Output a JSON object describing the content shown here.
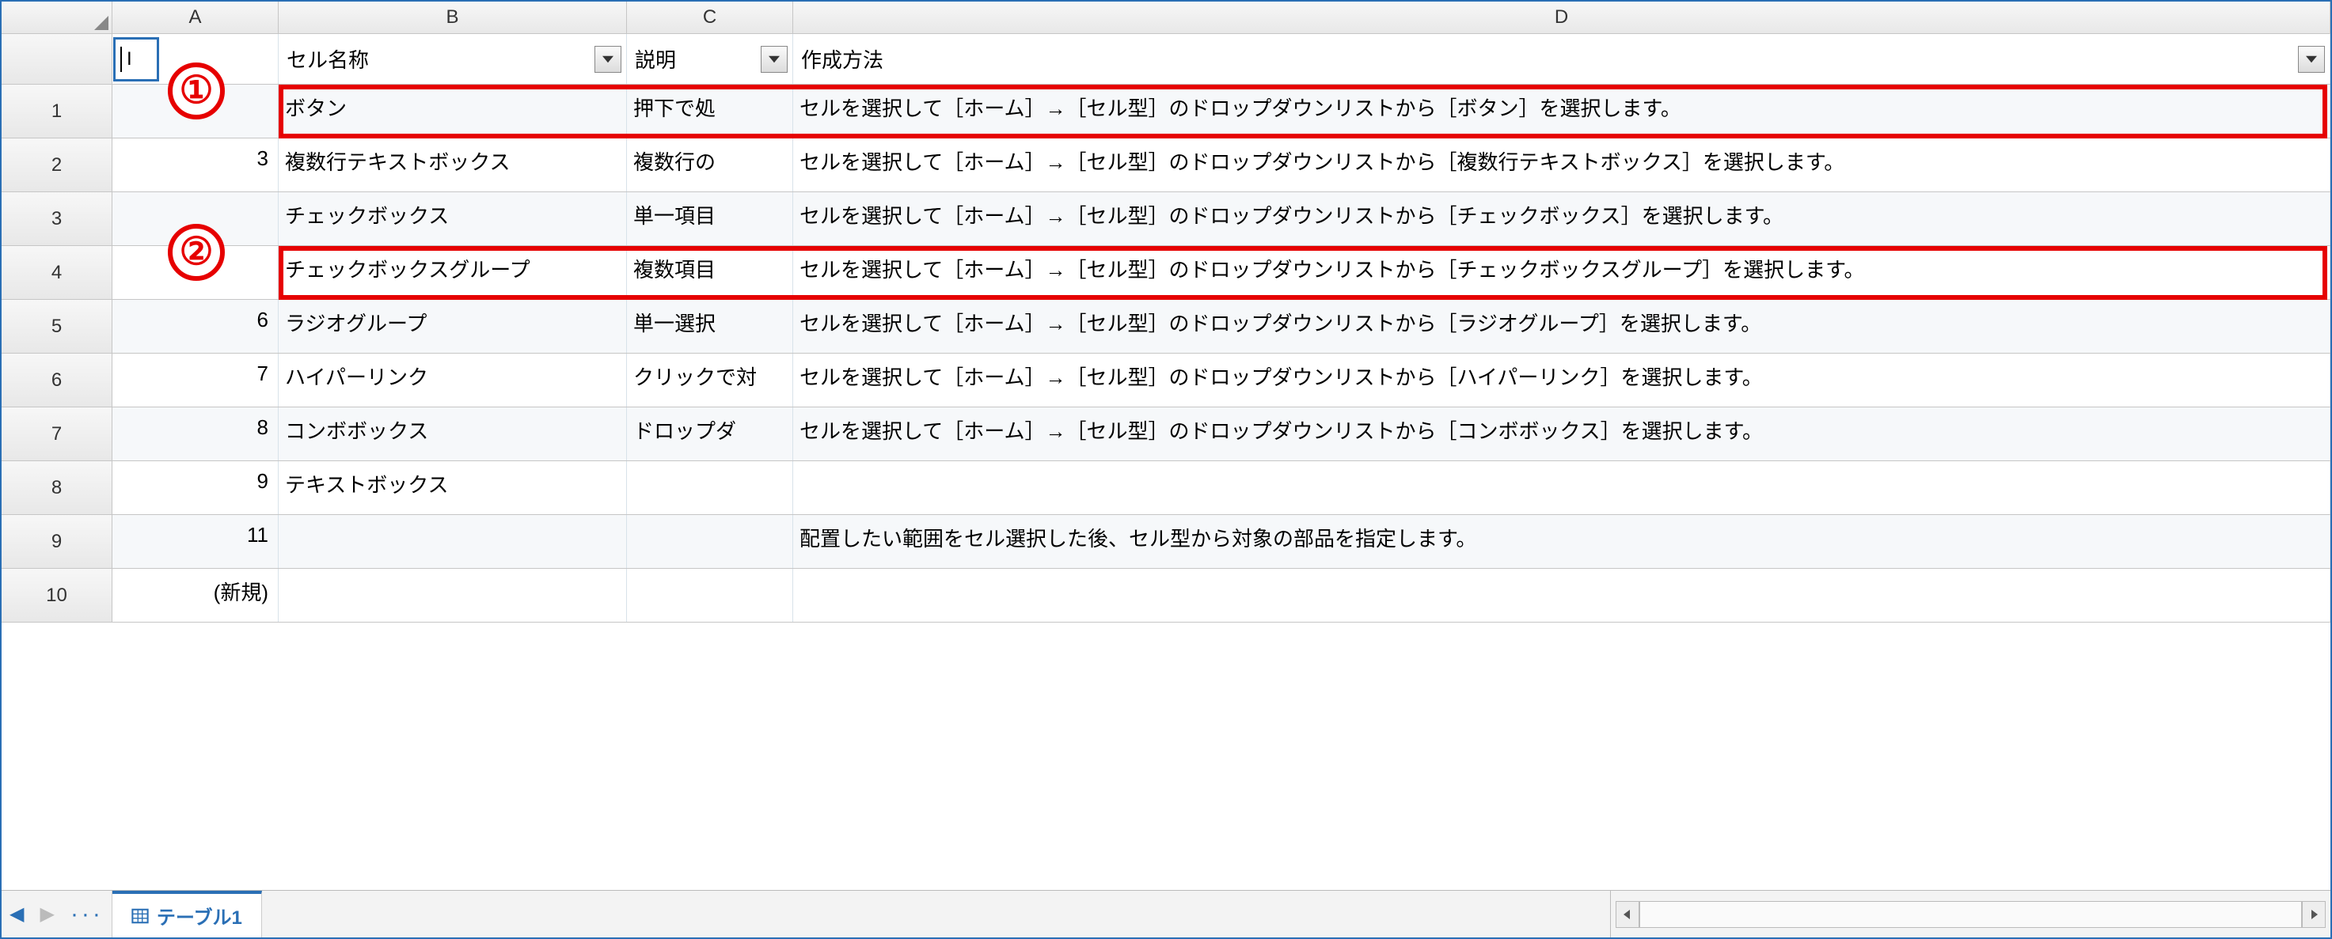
{
  "columns": [
    "A",
    "B",
    "C",
    "D"
  ],
  "filterRow": {
    "A_label": "I",
    "B": "セル名称",
    "C": "説明",
    "D": "作成方法"
  },
  "rows": [
    {
      "n": "1",
      "A": "",
      "B": "ボタン",
      "C": "押下で処",
      "D": "セルを選択して［ホーム］→［セル型］のドロップダウンリストから［ボタン］を選択します。"
    },
    {
      "n": "2",
      "A": "3",
      "B": "複数行テキストボックス",
      "C": "複数行の",
      "D": "セルを選択して［ホーム］→［セル型］のドロップダウンリストから［複数行テキストボックス］を選択します。"
    },
    {
      "n": "3",
      "A": "",
      "B": "チェックボックス",
      "C": "単一項目",
      "D": "セルを選択して［ホーム］→［セル型］のドロップダウンリストから［チェックボックス］を選択します。"
    },
    {
      "n": "4",
      "A": "",
      "B": "チェックボックスグループ",
      "C": "複数項目",
      "D": "セルを選択して［ホーム］→［セル型］のドロップダウンリストから［チェックボックスグループ］を選択します。"
    },
    {
      "n": "5",
      "A": "6",
      "B": "ラジオグループ",
      "C": "単一選択",
      "D": "セルを選択して［ホーム］→［セル型］のドロップダウンリストから［ラジオグループ］を選択します。"
    },
    {
      "n": "6",
      "A": "7",
      "B": "ハイパーリンク",
      "C": "クリックで対",
      "D": "セルを選択して［ホーム］→［セル型］のドロップダウンリストから［ハイパーリンク］を選択します。"
    },
    {
      "n": "7",
      "A": "8",
      "B": "コンボボックス",
      "C": "ドロップダ",
      "D": "セルを選択して［ホーム］→［セル型］のドロップダウンリストから［コンボボックス］を選択します。"
    },
    {
      "n": "8",
      "A": "9",
      "B": "テキストボックス",
      "C": "",
      "D": ""
    },
    {
      "n": "9",
      "A": "11",
      "B": "",
      "C": "",
      "D": "配置したい範囲をセル選択した後、セル型から対象の部品を指定します。"
    },
    {
      "n": "10",
      "A": "(新規)",
      "B": "",
      "C": "",
      "D": ""
    }
  ],
  "callouts": {
    "one": "①",
    "two": "②"
  },
  "sheetTab": "テーブル1"
}
